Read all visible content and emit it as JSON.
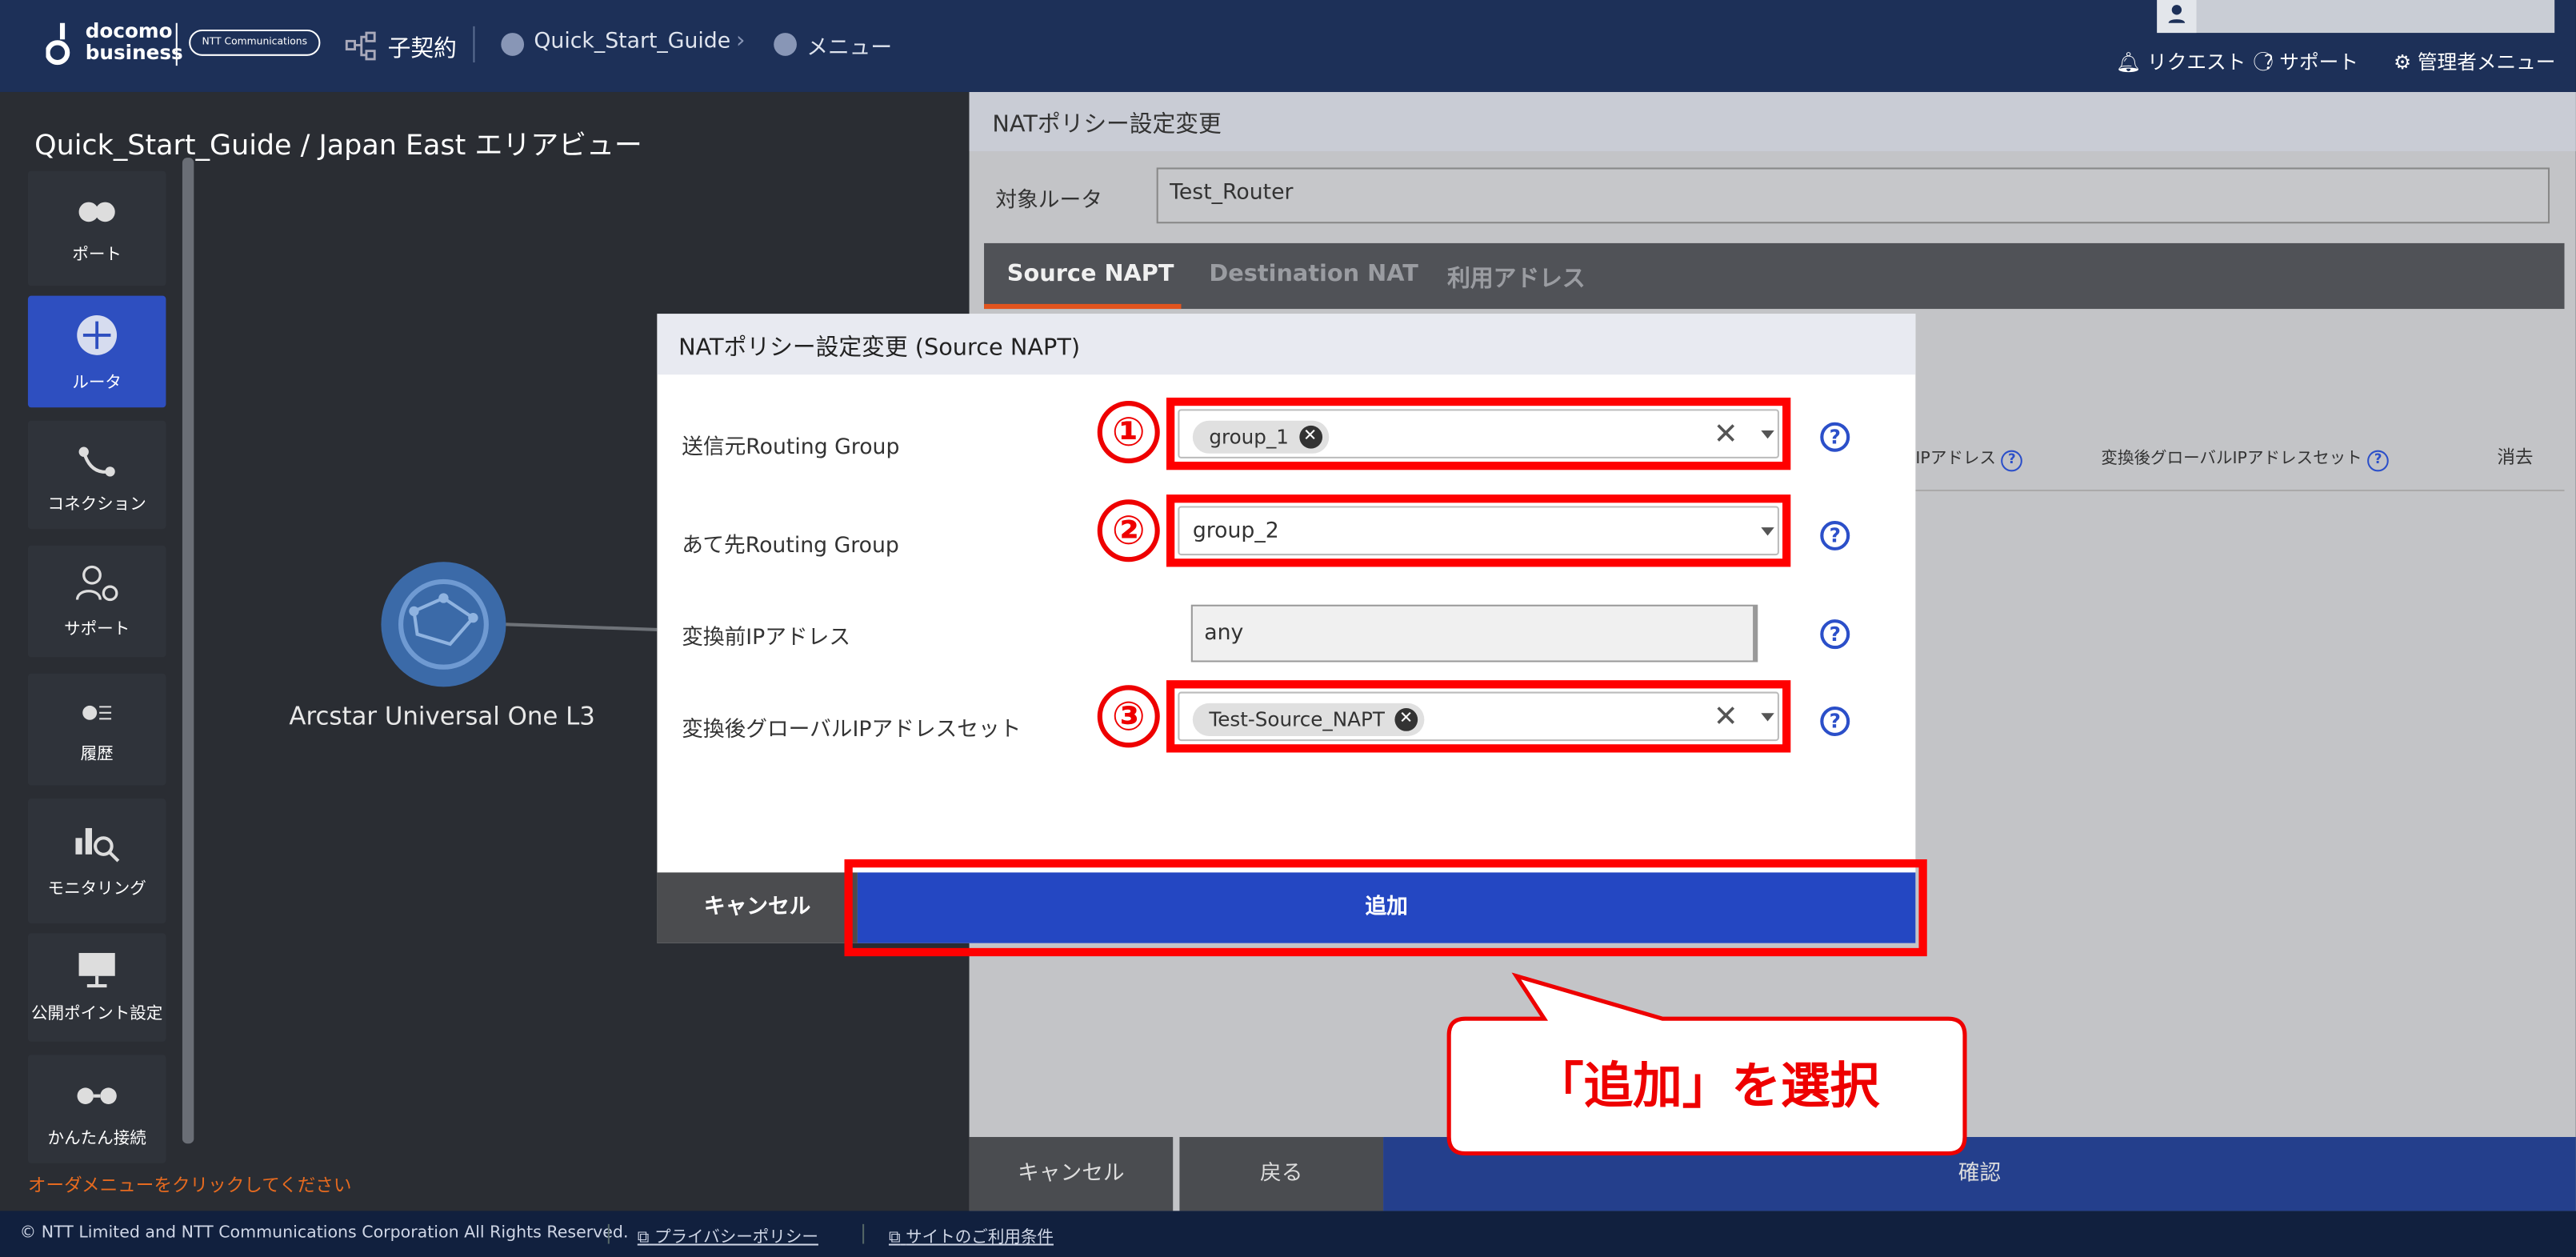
{
  "header": {
    "logo_top": "docomo",
    "logo_bottom": "business",
    "logo_partner": "NTT Communications",
    "sub_contract_label": "子契約",
    "breadcrumb_1": "Quick_Start_Guide",
    "breadcrumb_2": "メニュー",
    "request_label": "リクエスト",
    "support_label": "サポート",
    "admin_label": "管理者メニュー"
  },
  "left_panel": {
    "title": "Quick_Start_Guide / Japan East エリアビュー",
    "nav": [
      {
        "label": "ポート",
        "icon": "port-icon"
      },
      {
        "label": "ルータ",
        "icon": "router-icon"
      },
      {
        "label": "コネクション",
        "icon": "connection-icon"
      },
      {
        "label": "サポート",
        "icon": "support-icon"
      },
      {
        "label": "履歴",
        "icon": "history-icon"
      },
      {
        "label": "モニタリング",
        "icon": "monitoring-icon"
      },
      {
        "label": "公開ポイント設定",
        "icon": "public-point-icon"
      },
      {
        "label": "かんたん接続",
        "icon": "easy-connect-icon"
      }
    ],
    "node_label": "Arcstar Universal One L3",
    "order_hint": "オーダメニューをクリックしてください"
  },
  "right_panel": {
    "title": "NATポリシー設定変更",
    "router_label": "対象ルータ",
    "router_value": "Test_Router",
    "tabs": [
      "Source NAPT",
      "Destination NAT",
      "利用アドレス"
    ],
    "col_ip": "IPアドレス",
    "col_global_set": "変換後グローバルIPアドレスセット",
    "col_delete": "消去",
    "cancel_label": "キャンセル",
    "back_label": "戻る",
    "confirm_label": "確認"
  },
  "modal": {
    "title": "NATポリシー設定変更 (Source NAPT)",
    "source_group_label": "送信元Routing Group",
    "source_group_chip": "group_1",
    "dest_group_label": "あて先Routing Group",
    "dest_group_value": "group_2",
    "pre_ip_label": "変換前IPアドレス",
    "pre_ip_value": "any",
    "post_ip_set_label": "変換後グローバルIPアドレスセット",
    "post_ip_set_chip": "Test-Source_NAPT",
    "cancel_label": "キャンセル",
    "add_label": "追加"
  },
  "annotations": {
    "step_1": "①",
    "step_2": "②",
    "step_3": "③",
    "callout": "「追加」を選択"
  },
  "footer": {
    "copyright": "© NTT Limited and NTT Communications Corporation All Rights Reserved.",
    "privacy": "プライバシーポリシー",
    "terms": "サイトのご利用条件"
  },
  "colors": {
    "header_bg": "#1d3058",
    "accent_blue": "#2447c2",
    "highlight_red": "#ff0000",
    "tab_active_underline": "#e2541e"
  }
}
